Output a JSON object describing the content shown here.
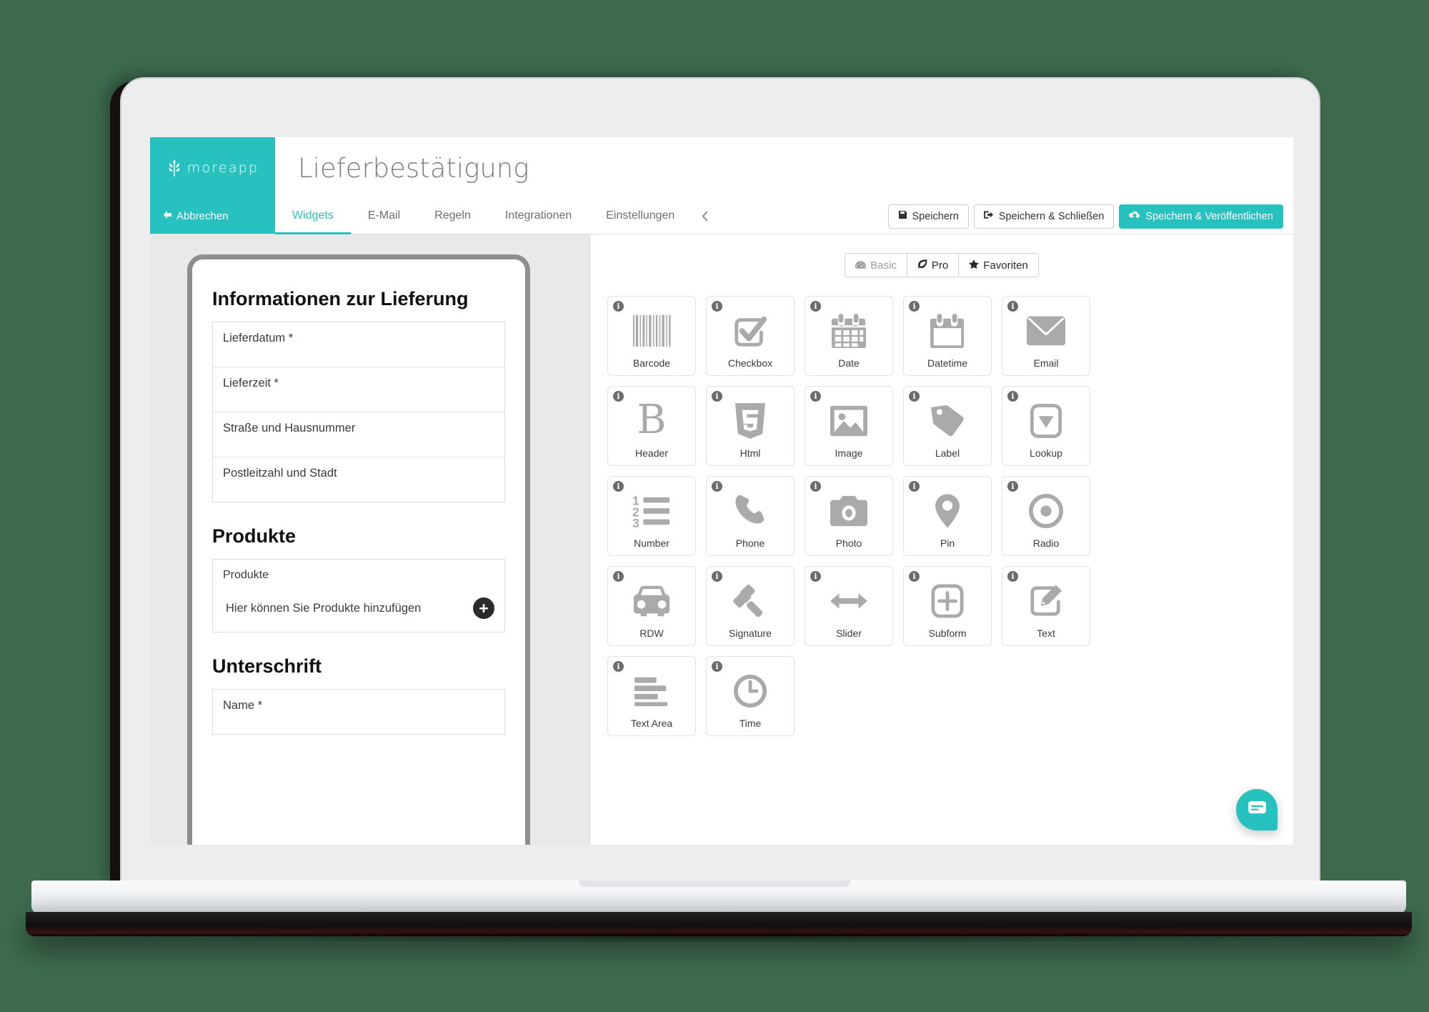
{
  "brand": {
    "name": "moreapp",
    "logo_icon": "wheat-logo-icon",
    "color": "#27c2c0"
  },
  "header": {
    "title": "Lieferbestätigung"
  },
  "nav": {
    "cancel_label": "Abbrechen",
    "cancel_icon": "arrow-left-icon",
    "collapse_icon": "chevron-left-icon",
    "tabs": [
      {
        "label": "Widgets",
        "active": true
      },
      {
        "label": "E-Mail",
        "active": false
      },
      {
        "label": "Regeln",
        "active": false
      },
      {
        "label": "Integrationen",
        "active": false
      },
      {
        "label": "Einstellungen",
        "active": false
      }
    ]
  },
  "actions": [
    {
      "label": "Speichern",
      "icon": "floppy-disk-icon",
      "primary": false
    },
    {
      "label": "Speichern & Schließen",
      "icon": "sign-out-icon",
      "primary": false
    },
    {
      "label": "Speichern & Veröffentlichen",
      "icon": "cloud-upload-icon",
      "primary": true
    }
  ],
  "preview": {
    "sections": [
      {
        "title": "Informationen zur Lieferung",
        "type": "fields",
        "fields": [
          {
            "label": "Lieferdatum *"
          },
          {
            "label": "Lieferzeit *"
          },
          {
            "label": "Straße und Hausnummer"
          },
          {
            "label": "Postleitzahl und Stadt"
          }
        ]
      },
      {
        "title": "Produkte",
        "type": "subform",
        "subform_title": "Produkte",
        "subform_hint": "Hier können Sie Produkte hinzufügen",
        "add_icon": "plus-circle-icon"
      },
      {
        "title": "Unterschrift",
        "type": "fields",
        "fields": [
          {
            "label": "Name *"
          }
        ]
      }
    ]
  },
  "widget_panel": {
    "filters": [
      {
        "label": "Basic",
        "icon": "dashboard-icon",
        "active": true
      },
      {
        "label": "Pro",
        "icon": "leaf-icon",
        "active": false
      },
      {
        "label": "Favoriten",
        "icon": "star-icon",
        "active": false
      }
    ],
    "info_badge": "i",
    "widgets": [
      {
        "label": "Barcode",
        "icon": "barcode-icon"
      },
      {
        "label": "Checkbox",
        "icon": "checkbox-icon"
      },
      {
        "label": "Date",
        "icon": "calendar-icon"
      },
      {
        "label": "Datetime",
        "icon": "calendar-blank-icon"
      },
      {
        "label": "Email",
        "icon": "envelope-icon"
      },
      {
        "label": "Header",
        "icon": "bold-b-icon"
      },
      {
        "label": "Html",
        "icon": "html5-shield-icon"
      },
      {
        "label": "Image",
        "icon": "image-icon"
      },
      {
        "label": "Label",
        "icon": "tag-icon"
      },
      {
        "label": "Lookup",
        "icon": "dropdown-icon"
      },
      {
        "label": "Number",
        "icon": "numbered-list-icon"
      },
      {
        "label": "Phone",
        "icon": "phone-icon"
      },
      {
        "label": "Photo",
        "icon": "camera-icon"
      },
      {
        "label": "Pin",
        "icon": "map-pin-icon"
      },
      {
        "label": "Radio",
        "icon": "radio-button-icon"
      },
      {
        "label": "RDW",
        "icon": "car-icon"
      },
      {
        "label": "Signature",
        "icon": "gavel-icon"
      },
      {
        "label": "Slider",
        "icon": "arrows-horizontal-icon"
      },
      {
        "label": "Subform",
        "icon": "plus-square-icon"
      },
      {
        "label": "Text",
        "icon": "pencil-square-icon"
      },
      {
        "label": "Text Area",
        "icon": "text-lines-icon"
      },
      {
        "label": "Time",
        "icon": "clock-icon"
      }
    ]
  },
  "chat": {
    "icon": "chat-bubble-icon"
  }
}
